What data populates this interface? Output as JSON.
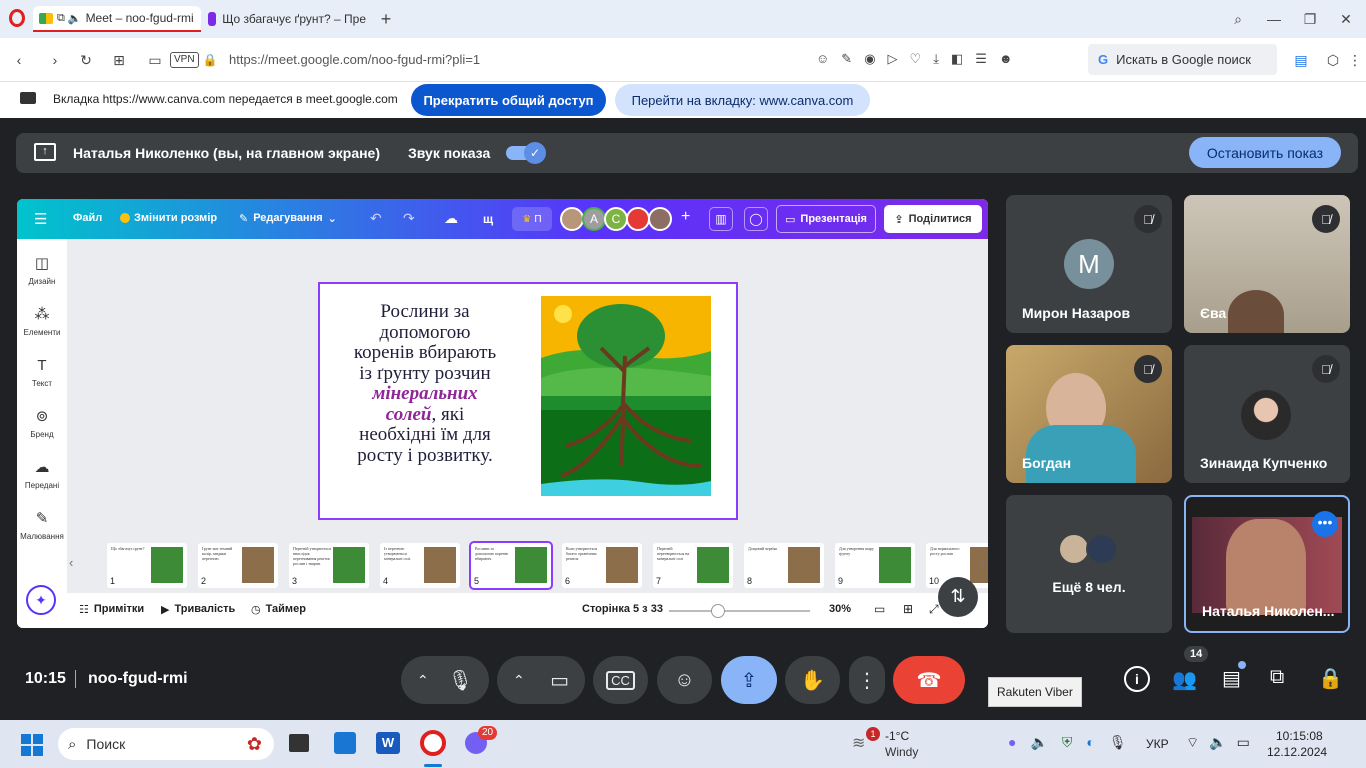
{
  "browser": {
    "tabs": [
      {
        "label": "Meet – noo-fgud-rmi"
      },
      {
        "label": "Що збагачує ґрунт? – Пре"
      }
    ],
    "url": "https://meet.google.com/noo-fgud-rmi?pli=1",
    "vpn_label": "VPN",
    "search_placeholder": "Искать в Google поиск"
  },
  "share_bar": {
    "message": "Вкладка https://www.canva.com передается в meet.google.com",
    "stop_button": "Прекратить общий доступ",
    "goto_button": "Перейти на вкладку: www.canva.com"
  },
  "presenter_bar": {
    "name": "Наталья Николенко (вы, на главном экране)",
    "sound_label": "Звук показа",
    "stop_button": "Остановить показ"
  },
  "canva": {
    "menu": {
      "file": "Файл",
      "resize": "Змінити розмір",
      "edit": "Редагування",
      "extra": "щ",
      "crown": "П",
      "present": "Презентація",
      "share": "Поділитися"
    },
    "avatars": [
      "A",
      "C"
    ],
    "sidebar": [
      {
        "label": "Дизайн",
        "icon": "layout-icon"
      },
      {
        "label": "Елементи",
        "icon": "shapes-icon"
      },
      {
        "label": "Текст",
        "icon": "text-icon"
      },
      {
        "label": "Бренд",
        "icon": "brand-icon"
      },
      {
        "label": "Передані",
        "icon": "upload-icon"
      },
      {
        "label": "Малювання",
        "icon": "pen-icon"
      }
    ],
    "slide": {
      "text_before": "Рослини за допомогою коренів вбирають із ґрунту розчин ",
      "highlight": "мінеральних солей",
      "text_after": ", які необхідні їм для росту і розвитку."
    },
    "thumbnails": [
      {
        "num": "1",
        "text": "Що збагачує ґрунт?"
      },
      {
        "num": "2",
        "text": "Ґрунт має темний колір, завдяки перегною."
      },
      {
        "num": "3",
        "text": "Перегній утворюється внаслідок перегнивання решток рослин і тварин."
      },
      {
        "num": "4",
        "text": "Із перегною утворюються мінеральні солі."
      },
      {
        "num": "5",
        "text": "Рослини за допомогою коренів вбирають"
      },
      {
        "num": "6",
        "text": "Коли утворюється багато органічних решток"
      },
      {
        "num": "7",
        "text": "Перегній перетворюється на мінеральні солі"
      },
      {
        "num": "8",
        "text": "Дощовий черв'як"
      },
      {
        "num": "9",
        "text": "Для утворення шару ґрунту"
      },
      {
        "num": "10",
        "text": "Для нормального росту рослин"
      }
    ],
    "footer": {
      "notes": "Примітки",
      "duration": "Тривалість",
      "timer": "Таймер",
      "page": "Сторінка 5 з 33",
      "zoom": "30%",
      "zoom_fraction": 0.3
    }
  },
  "participants": [
    {
      "name": "Мирон Назаров",
      "initial": "M",
      "avatar_color": "#78909c"
    },
    {
      "name": "Єва"
    },
    {
      "name": "Богдан"
    },
    {
      "name": "Зинаида Купченко"
    },
    {
      "name": "Ещё 8 чел."
    },
    {
      "name": "Наталья Николен..."
    }
  ],
  "bottom": {
    "time": "10:15",
    "meeting_code": "noo-fgud-rmi",
    "people_count": "14",
    "tooltip": "Rakuten Viber"
  },
  "taskbar": {
    "search": "Поиск",
    "viber_badge": "20",
    "weather_temp": "-1°C",
    "weather_place": "Windy",
    "weather_badge": "1",
    "lang": "УКР",
    "time": "10:15:08",
    "date": "12.12.2024"
  },
  "colors": {
    "accent": "#8ab4f8",
    "end_call": "#ea4335",
    "canva_purple": "#7d2ae8",
    "canva_teal": "#00c4cc"
  }
}
